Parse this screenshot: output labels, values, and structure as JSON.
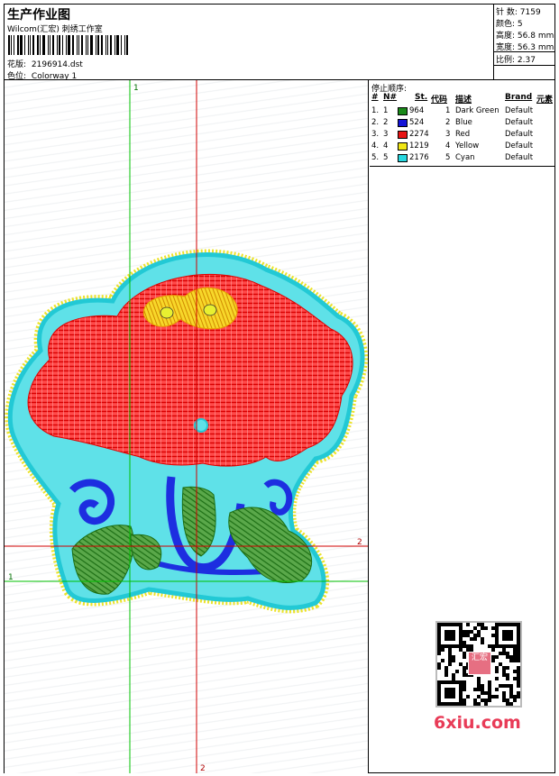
{
  "header": {
    "title": "生产作业图",
    "subtitle": "Wilcom(汇宏) 刺绣工作室",
    "design_label": "花版:",
    "design_file": "2196914.dst",
    "color_label": "色位:",
    "colorway": "Colorway 1"
  },
  "stats": [
    {
      "label": "针 数:",
      "value": "7159"
    },
    {
      "label": "颜色:",
      "value": "5"
    },
    {
      "label": "高度:",
      "value": "56.8 mm"
    },
    {
      "label": "宽度:",
      "value": "56.3 mm"
    },
    {
      "label": "比例:",
      "value": "2.37"
    }
  ],
  "guides": {
    "v1_label": "1",
    "v2_label": "2",
    "h1_label": "1",
    "h2_label": "2"
  },
  "stop_sequence": {
    "title": "停止顺序:",
    "columns": {
      "stop": "#",
      "needle": "N#",
      "stitches": "St.",
      "code": "代码",
      "description": "描述",
      "brand": "Brand",
      "element": "元素"
    },
    "rows": [
      {
        "stop": "1.",
        "needle": "1",
        "color": "#1a8a1a",
        "stitches": "964",
        "code": "1",
        "description": "Dark Green",
        "brand": "Default"
      },
      {
        "stop": "2.",
        "needle": "2",
        "color": "#1414d8",
        "stitches": "524",
        "code": "2",
        "description": "Blue",
        "brand": "Default"
      },
      {
        "stop": "3.",
        "needle": "3",
        "color": "#e81414",
        "stitches": "2274",
        "code": "3",
        "description": "Red",
        "brand": "Default"
      },
      {
        "stop": "4.",
        "needle": "4",
        "color": "#f0e614",
        "stitches": "1219",
        "code": "4",
        "description": "Yellow",
        "brand": "Default"
      },
      {
        "stop": "5.",
        "needle": "5",
        "color": "#28d8e0",
        "stitches": "2176",
        "code": "5",
        "description": "Cyan",
        "brand": "Default"
      }
    ]
  },
  "watermark": {
    "text": "6xiu.com",
    "stamp": "汇宏"
  }
}
